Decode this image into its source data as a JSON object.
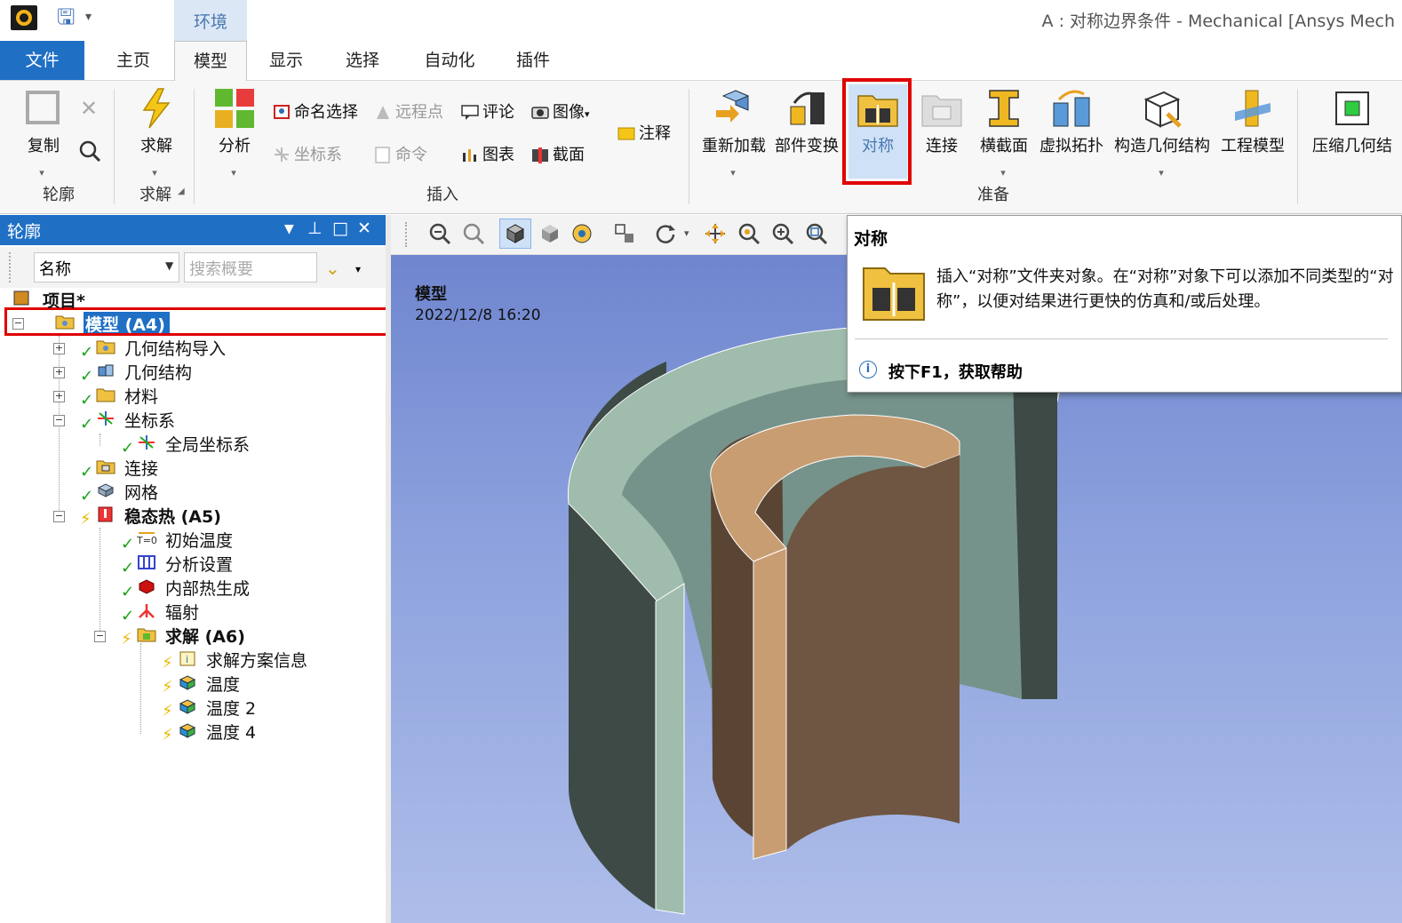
{
  "window": {
    "title": "A : 对称边界条件 - Mechanical [Ansys Mech",
    "context_tab": "环境"
  },
  "tabs": [
    {
      "label": "文件"
    },
    {
      "label": "主页"
    },
    {
      "label": "模型"
    },
    {
      "label": "显示"
    },
    {
      "label": "选择"
    },
    {
      "label": "自动化"
    },
    {
      "label": "插件"
    }
  ],
  "ribbon": {
    "outline_group": {
      "label": "轮廓",
      "copy": "复制"
    },
    "solve_group": {
      "label": "求解",
      "solve": "求解"
    },
    "insert_group": {
      "label": "插入",
      "analysis": "分析",
      "named_selection": "命名选择",
      "remote_point": "远程点",
      "comment": "评论",
      "image": "图像",
      "coordinate_system": "坐标系",
      "command": "命令",
      "chart": "图表",
      "section": "截面",
      "annotation": "注释"
    },
    "prepare_group": {
      "label": "准备",
      "reload": "重新加载",
      "part_transform": "部件变换",
      "symmetry": "对称",
      "connection": "连接",
      "cross_section": "横截面",
      "virtual_topology": "虚拟拓扑",
      "construction_geometry": "构造几何结构",
      "engineering_model": "工程模型"
    },
    "condense_geometry": "压缩几何结"
  },
  "outline": {
    "title": "轮廓",
    "filter_select": "名称",
    "search_placeholder": "搜索概要",
    "tree": [
      {
        "label": "项目*"
      },
      {
        "label": "模型 (A4)"
      },
      {
        "label": "几何结构导入"
      },
      {
        "label": "几何结构"
      },
      {
        "label": "材料"
      },
      {
        "label": "坐标系"
      },
      {
        "label": "全局坐标系"
      },
      {
        "label": "连接"
      },
      {
        "label": "网格"
      },
      {
        "label": "稳态热 (A5)"
      },
      {
        "label": "初始温度"
      },
      {
        "label": "分析设置"
      },
      {
        "label": "内部热生成"
      },
      {
        "label": "辐射"
      },
      {
        "label": "求解 (A6)"
      },
      {
        "label": "求解方案信息"
      },
      {
        "label": "温度"
      },
      {
        "label": "温度 2"
      },
      {
        "label": "温度 4"
      }
    ]
  },
  "viewport": {
    "title": "模型",
    "timestamp": "2022/12/8 16:20"
  },
  "tooltip": {
    "title": "对称",
    "description": "插入“对称”文件夹对象。在“对称”对象下可以添加不同类型的“对称”，以便对结果进行更快的仿真和/或后处理。",
    "help": "按下F1，获取帮助"
  },
  "colors": {
    "accent": "#1f6fc5",
    "highlight_red": "#e00000",
    "outer_cylinder": "#9bb8a8",
    "inner_cylinder": "#c89a72"
  }
}
